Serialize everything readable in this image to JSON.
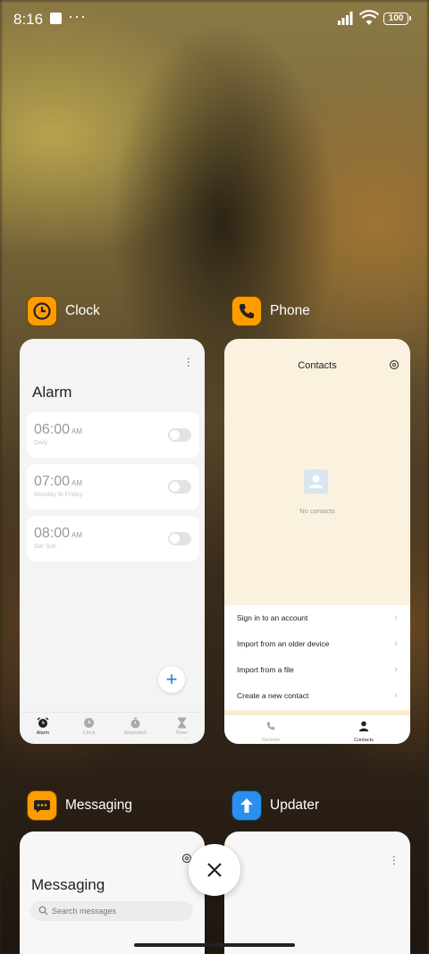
{
  "status_bar": {
    "time": "8:16",
    "dots": "···",
    "battery": "100"
  },
  "apps": {
    "clock": {
      "name": "Clock",
      "title": "Alarm",
      "alarms": [
        {
          "time": "06:00",
          "ampm": "AM",
          "repeat": "Daily",
          "enabled": false
        },
        {
          "time": "07:00",
          "ampm": "AM",
          "repeat": "Monday to Friday",
          "enabled": false
        },
        {
          "time": "08:00",
          "ampm": "AM",
          "repeat": "Sat Sun",
          "enabled": false
        }
      ],
      "fab": "+",
      "tabs": [
        "Alarm",
        "Clock",
        "Stopwatch",
        "Timer"
      ]
    },
    "phone": {
      "name": "Phone",
      "title": "Contacts",
      "empty_text": "No contacts",
      "menu": [
        "Sign in to an account",
        "Import from an older device",
        "Import from a file",
        "Create a new contact"
      ],
      "tabs": [
        "Recents",
        "Contacts"
      ]
    },
    "messaging": {
      "name": "Messaging",
      "title": "Messaging",
      "search_placeholder": "Search messages"
    },
    "updater": {
      "name": "Updater"
    }
  },
  "colors": {
    "accent_orange": "#ff9d00",
    "accent_blue": "#1e7fe6"
  }
}
